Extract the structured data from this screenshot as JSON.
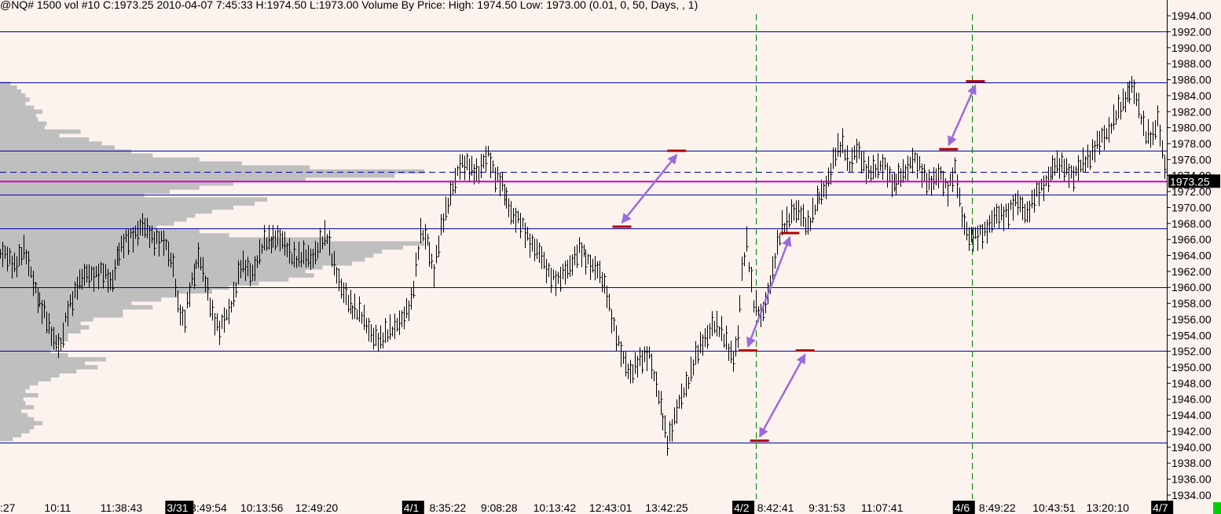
{
  "header": {
    "text": "@NQ#  1500 vol  #10  C:1973.25  2010-04-07  7:45:33  H:1974.50  L:1973.00  Volume By Price:  High: 1974.50  Low: 1973.00   (0.01, 0, 50, Days, , 1)"
  },
  "colors": {
    "background": "#fdf3ee",
    "hline": "#0000b0",
    "vline": "#008000",
    "volume_profile": "#bfbfbf",
    "price_bars": "#000000",
    "last_price_line": "#c800c8",
    "marker": "#b00000",
    "arrow": "#9a6adf"
  },
  "chart_data": {
    "type": "bar",
    "symbol": "@NQ#",
    "y_axis": {
      "side": "right",
      "ylim": [
        1933.5,
        1994.6
      ],
      "ticks": [
        1994,
        1992,
        1990,
        1988,
        1986,
        1984,
        1982,
        1980,
        1978,
        1976,
        1974,
        1972,
        1970,
        1968,
        1966,
        1964,
        1962,
        1960,
        1958,
        1956,
        1954,
        1952,
        1950,
        1948,
        1946,
        1944,
        1942,
        1940,
        1938,
        1936,
        1934
      ],
      "tick_labels": [
        "1994.00",
        "1992.00",
        "1990.00",
        "1988.00",
        "1986.00",
        "1984.00",
        "1982.00",
        "1980.00",
        "1978.00",
        "1976.00",
        "1974.00",
        "1972.00",
        "1970.00",
        "1968.00",
        "1966.00",
        "1964.00",
        "1962.00",
        "1960.00",
        "1958.00",
        "1956.00",
        "1954.00",
        "1952.00",
        "1950.00",
        "1948.00",
        "1946.00",
        "1944.00",
        "1942.00",
        "1940.00",
        "1938.00",
        "1936.00",
        "1934.00"
      ]
    },
    "last_price": 1973.25,
    "last_price_label": "1973.25",
    "dashed_level": 1974.5,
    "horizontal_levels": [
      1992.0,
      1985.7,
      1977.1,
      1971.6,
      1967.4,
      1960.0,
      1952.1,
      1940.6
    ],
    "x_axis": {
      "bar_count": 1000,
      "labels": [
        {
          "text": ":27",
          "index": 0,
          "session": false
        },
        {
          "text": "10:11",
          "index": 38,
          "session": false
        },
        {
          "text": "11:38:43",
          "index": 86,
          "session": false
        },
        {
          "text": "3/31",
          "index": 143,
          "session": true
        },
        {
          "text": "8:49:54",
          "index": 163,
          "session": false
        },
        {
          "text": "10:13:56",
          "index": 206,
          "session": false
        },
        {
          "text": "12:49:20",
          "index": 253,
          "session": false
        },
        {
          "text": "4/1",
          "index": 346,
          "session": true
        },
        {
          "text": "8:35:22",
          "index": 368,
          "session": false
        },
        {
          "text": "9:08:28",
          "index": 412,
          "session": false
        },
        {
          "text": "10:13:42",
          "index": 457,
          "session": false
        },
        {
          "text": "12:43:01",
          "index": 505,
          "session": false
        },
        {
          "text": "13:42:25",
          "index": 553,
          "session": false
        },
        {
          "text": "4/2",
          "index": 629,
          "session": true
        },
        {
          "text": "8:42:41",
          "index": 649,
          "session": false
        },
        {
          "text": "9:31:53",
          "index": 693,
          "session": false
        },
        {
          "text": "11:07:41",
          "index": 738,
          "session": false
        },
        {
          "text": "4/6",
          "index": 818,
          "session": true
        },
        {
          "text": "8:49:22",
          "index": 839,
          "session": false
        },
        {
          "text": "10:43:51",
          "index": 885,
          "session": false
        },
        {
          "text": "13:20:10",
          "index": 931,
          "session": false
        },
        {
          "text": "4/7",
          "index": 988,
          "session": true
        }
      ],
      "session_dividers": [
        648,
        833
      ]
    },
    "price_path": [
      [
        0,
        1964.2
      ],
      [
        12,
        1963.0
      ],
      [
        20,
        1964.5
      ],
      [
        28,
        1961.0
      ],
      [
        35,
        1957.5
      ],
      [
        45,
        1954.0
      ],
      [
        52,
        1952.5
      ],
      [
        58,
        1957.0
      ],
      [
        66,
        1960.5
      ],
      [
        75,
        1961.5
      ],
      [
        85,
        1962.0
      ],
      [
        95,
        1960.5
      ],
      [
        100,
        1964.0
      ],
      [
        112,
        1966.5
      ],
      [
        122,
        1967.5
      ],
      [
        130,
        1966.5
      ],
      [
        140,
        1965.5
      ],
      [
        148,
        1963.0
      ],
      [
        152,
        1958.0
      ],
      [
        157,
        1955.0
      ],
      [
        163,
        1960.5
      ],
      [
        170,
        1964.0
      ],
      [
        176,
        1960.5
      ],
      [
        182,
        1957.0
      ],
      [
        188,
        1954.5
      ],
      [
        196,
        1957.0
      ],
      [
        206,
        1962.5
      ],
      [
        216,
        1962.0
      ],
      [
        226,
        1965.5
      ],
      [
        236,
        1966.5
      ],
      [
        248,
        1964.5
      ],
      [
        256,
        1963.5
      ],
      [
        268,
        1964.0
      ],
      [
        280,
        1966.5
      ],
      [
        292,
        1959.5
      ],
      [
        306,
        1957.0
      ],
      [
        318,
        1954.5
      ],
      [
        326,
        1953.0
      ],
      [
        334,
        1955.0
      ],
      [
        344,
        1955.5
      ],
      [
        352,
        1958.5
      ],
      [
        360,
        1966.5
      ],
      [
        366,
        1966.0
      ],
      [
        372,
        1962.0
      ],
      [
        378,
        1967.0
      ],
      [
        386,
        1972.0
      ],
      [
        394,
        1975.0
      ],
      [
        402,
        1975.5
      ],
      [
        410,
        1974.0
      ],
      [
        418,
        1977.0
      ],
      [
        424,
        1974.0
      ],
      [
        430,
        1972.5
      ],
      [
        440,
        1969.0
      ],
      [
        450,
        1967.0
      ],
      [
        460,
        1964.5
      ],
      [
        468,
        1962.5
      ],
      [
        478,
        1960.5
      ],
      [
        486,
        1962.5
      ],
      [
        496,
        1964.5
      ],
      [
        504,
        1963.5
      ],
      [
        512,
        1962.0
      ],
      [
        520,
        1959.5
      ],
      [
        526,
        1955.0
      ],
      [
        532,
        1951.5
      ],
      [
        540,
        1949.5
      ],
      [
        548,
        1950.5
      ],
      [
        556,
        1952.0
      ],
      [
        562,
        1947.5
      ],
      [
        568,
        1943.5
      ],
      [
        572,
        1941.0
      ],
      [
        578,
        1943.5
      ],
      [
        586,
        1947.0
      ],
      [
        594,
        1950.5
      ],
      [
        602,
        1953.0
      ],
      [
        610,
        1955.5
      ],
      [
        616,
        1954.5
      ],
      [
        622,
        1953.5
      ],
      [
        628,
        1951.0
      ],
      [
        632,
        1953.5
      ],
      [
        636,
        1962.0
      ],
      [
        640,
        1966.0
      ],
      [
        646,
        1958.0
      ],
      [
        652,
        1956.0
      ],
      [
        658,
        1959.5
      ],
      [
        664,
        1963.5
      ],
      [
        670,
        1967.5
      ],
      [
        678,
        1969.5
      ],
      [
        686,
        1969.0
      ],
      [
        692,
        1968.0
      ],
      [
        700,
        1970.5
      ],
      [
        708,
        1973.0
      ],
      [
        716,
        1976.5
      ],
      [
        722,
        1978.0
      ],
      [
        728,
        1975.5
      ],
      [
        734,
        1977.0
      ],
      [
        742,
        1975.0
      ],
      [
        750,
        1974.5
      ],
      [
        758,
        1975.5
      ],
      [
        766,
        1972.5
      ],
      [
        774,
        1974.5
      ],
      [
        782,
        1976.0
      ],
      [
        790,
        1974.5
      ],
      [
        798,
        1973.0
      ],
      [
        806,
        1974.0
      ],
      [
        812,
        1972.5
      ],
      [
        818,
        1974.5
      ],
      [
        824,
        1969.0
      ],
      [
        830,
        1966.5
      ],
      [
        836,
        1966.0
      ],
      [
        842,
        1967.0
      ],
      [
        852,
        1968.5
      ],
      [
        862,
        1969.5
      ],
      [
        872,
        1970.5
      ],
      [
        880,
        1969.5
      ],
      [
        888,
        1971.5
      ],
      [
        896,
        1973.5
      ],
      [
        904,
        1975.0
      ],
      [
        912,
        1975.5
      ],
      [
        920,
        1973.5
      ],
      [
        928,
        1976.0
      ],
      [
        936,
        1976.5
      ],
      [
        944,
        1979.0
      ],
      [
        952,
        1980.0
      ],
      [
        958,
        1982.0
      ],
      [
        964,
        1984.0
      ],
      [
        970,
        1985.0
      ],
      [
        976,
        1982.5
      ],
      [
        982,
        1979.5
      ],
      [
        988,
        1978.5
      ],
      [
        992,
        1981.0
      ],
      [
        996,
        1977.5
      ],
      [
        1000,
        1973.2
      ]
    ],
    "volume_profile": [
      {
        "price": 1985.5,
        "width": 0.025
      },
      {
        "price": 1985.0,
        "width": 0.04
      },
      {
        "price": 1984.5,
        "width": 0.05
      },
      {
        "price": 1984.0,
        "width": 0.06
      },
      {
        "price": 1983.5,
        "width": 0.07
      },
      {
        "price": 1983.0,
        "width": 0.06
      },
      {
        "price": 1982.5,
        "width": 0.08
      },
      {
        "price": 1982.0,
        "width": 0.1
      },
      {
        "price": 1981.5,
        "width": 0.085
      },
      {
        "price": 1981.0,
        "width": 0.09
      },
      {
        "price": 1980.5,
        "width": 0.11
      },
      {
        "price": 1980.0,
        "width": 0.105
      },
      {
        "price": 1979.5,
        "width": 0.19
      },
      {
        "price": 1979.0,
        "width": 0.14
      },
      {
        "price": 1978.5,
        "width": 0.21
      },
      {
        "price": 1978.0,
        "width": 0.24
      },
      {
        "price": 1977.5,
        "width": 0.27
      },
      {
        "price": 1977.0,
        "width": 0.31
      },
      {
        "price": 1976.5,
        "width": 0.36
      },
      {
        "price": 1976.0,
        "width": 0.47
      },
      {
        "price": 1975.5,
        "width": 0.57
      },
      {
        "price": 1975.0,
        "width": 0.73
      },
      {
        "price": 1974.5,
        "width": 1.0
      },
      {
        "price": 1974.0,
        "width": 0.93
      },
      {
        "price": 1973.5,
        "width": 0.72
      },
      {
        "price": 1973.0,
        "width": 0.55
      },
      {
        "price": 1972.5,
        "width": 0.47
      },
      {
        "price": 1972.0,
        "width": 0.4
      },
      {
        "price": 1971.5,
        "width": 0.34
      },
      {
        "price": 1971.0,
        "width": 0.63
      },
      {
        "price": 1970.5,
        "width": 0.6
      },
      {
        "price": 1970.0,
        "width": 0.55
      },
      {
        "price": 1969.5,
        "width": 0.5
      },
      {
        "price": 1969.0,
        "width": 0.46
      },
      {
        "price": 1968.5,
        "width": 0.44
      },
      {
        "price": 1968.0,
        "width": 0.41
      },
      {
        "price": 1967.5,
        "width": 0.37
      },
      {
        "price": 1967.0,
        "width": 0.47
      },
      {
        "price": 1966.5,
        "width": 0.54
      },
      {
        "price": 1966.0,
        "width": 0.78
      },
      {
        "price": 1965.5,
        "width": 1.0
      },
      {
        "price": 1965.0,
        "width": 0.95
      },
      {
        "price": 1964.5,
        "width": 0.9
      },
      {
        "price": 1964.0,
        "width": 0.88
      },
      {
        "price": 1963.5,
        "width": 0.86
      },
      {
        "price": 1963.0,
        "width": 0.83
      },
      {
        "price": 1962.5,
        "width": 0.76
      },
      {
        "price": 1962.0,
        "width": 0.72
      },
      {
        "price": 1961.5,
        "width": 0.74
      },
      {
        "price": 1961.0,
        "width": 0.68
      },
      {
        "price": 1960.5,
        "width": 0.61
      },
      {
        "price": 1960.0,
        "width": 0.54
      },
      {
        "price": 1959.5,
        "width": 0.5
      },
      {
        "price": 1959.0,
        "width": 0.42
      },
      {
        "price": 1958.5,
        "width": 0.38
      },
      {
        "price": 1958.0,
        "width": 0.31
      },
      {
        "price": 1957.5,
        "width": 0.36
      },
      {
        "price": 1957.0,
        "width": 0.29
      },
      {
        "price": 1956.5,
        "width": 0.29
      },
      {
        "price": 1956.0,
        "width": 0.22
      },
      {
        "price": 1955.5,
        "width": 0.19
      },
      {
        "price": 1955.0,
        "width": 0.21
      },
      {
        "price": 1954.5,
        "width": 0.19
      },
      {
        "price": 1954.0,
        "width": 0.16
      },
      {
        "price": 1953.5,
        "width": 0.16
      },
      {
        "price": 1953.0,
        "width": 0.14
      },
      {
        "price": 1952.5,
        "width": 0.13
      },
      {
        "price": 1952.0,
        "width": 0.12
      },
      {
        "price": 1951.5,
        "width": 0.16
      },
      {
        "price": 1951.0,
        "width": 0.25
      },
      {
        "price": 1950.5,
        "width": 0.2
      },
      {
        "price": 1950.0,
        "width": 0.23
      },
      {
        "price": 1949.5,
        "width": 0.18
      },
      {
        "price": 1949.0,
        "width": 0.14
      },
      {
        "price": 1948.5,
        "width": 0.12
      },
      {
        "price": 1948.0,
        "width": 0.09
      },
      {
        "price": 1947.5,
        "width": 0.07
      },
      {
        "price": 1947.0,
        "width": 0.06
      },
      {
        "price": 1946.5,
        "width": 0.09
      },
      {
        "price": 1946.0,
        "width": 0.055
      },
      {
        "price": 1945.5,
        "width": 0.06
      },
      {
        "price": 1945.0,
        "width": 0.08
      },
      {
        "price": 1944.5,
        "width": 0.05
      },
      {
        "price": 1944.0,
        "width": 0.065
      },
      {
        "price": 1943.5,
        "width": 0.08
      },
      {
        "price": 1943.0,
        "width": 0.1
      },
      {
        "price": 1942.5,
        "width": 0.08
      },
      {
        "price": 1942.0,
        "width": 0.07
      },
      {
        "price": 1941.5,
        "width": 0.05
      },
      {
        "price": 1941.0,
        "width": 0.03
      }
    ],
    "volume_profile_max_label_free": true,
    "markers": [
      {
        "index": 580,
        "price": 1977.1
      },
      {
        "index": 533,
        "price": 1967.6
      },
      {
        "index": 677,
        "price": 1966.8
      },
      {
        "index": 641,
        "price": 1952.1
      },
      {
        "index": 690,
        "price": 1952.1
      },
      {
        "index": 651,
        "price": 1940.8
      },
      {
        "index": 836,
        "price": 1985.8
      },
      {
        "index": 813,
        "price": 1977.3
      }
    ],
    "arrows": [
      {
        "from_index": 533,
        "from_price": 1967.6,
        "to_index": 580,
        "to_price": 1977.1
      },
      {
        "from_index": 641,
        "from_price": 1952.1,
        "to_index": 677,
        "to_price": 1966.8
      },
      {
        "from_index": 651,
        "from_price": 1940.8,
        "to_index": 690,
        "to_price": 1952.1
      },
      {
        "from_index": 813,
        "from_price": 1977.3,
        "to_index": 836,
        "to_price": 1985.8
      }
    ]
  }
}
